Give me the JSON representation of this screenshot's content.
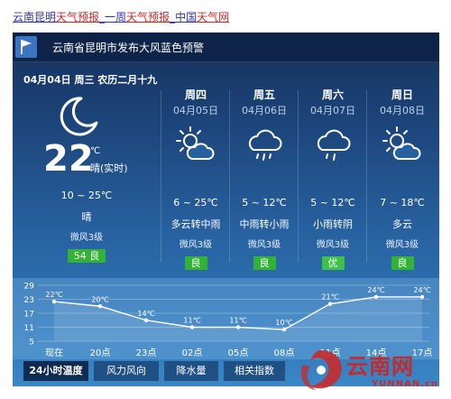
{
  "breadcrumb": [
    {
      "text": "云南昆明",
      "color": "#3333aa"
    },
    {
      "text": "天气预报",
      "color": "#cc2a2a"
    },
    {
      "text": "_",
      "color": "#3333aa"
    },
    {
      "text": "一周",
      "color": "#3333aa"
    },
    {
      "text": "天气预报",
      "color": "#cc2a2a"
    },
    {
      "text": "_",
      "color": "#3333aa"
    },
    {
      "text": "中国",
      "color": "#3333aa"
    },
    {
      "text": "天气网",
      "color": "#cc2a2a"
    }
  ],
  "alert": {
    "text": "云南省昆明市发布大风蓝色预警"
  },
  "today": {
    "date_text": "04月04日 周三 农历二月十九",
    "temp": "22",
    "unit": "℃",
    "status": "晴(实时)",
    "range": "10 ~ 25℃",
    "desc": "晴",
    "wind": "微风3级",
    "aqi": "54 良",
    "icon": "moon-icon"
  },
  "forecast": [
    {
      "day": "周四",
      "date": "04月05日",
      "icon": "partly-cloudy-icon",
      "range": "6 ~ 25℃",
      "desc": "多云转中雨",
      "wind": "微风3级",
      "aqi": "良"
    },
    {
      "day": "周五",
      "date": "04月06日",
      "icon": "rain-cloud-icon",
      "range": "5 ~ 12℃",
      "desc": "中雨转小雨",
      "wind": "微风3级",
      "aqi": "良"
    },
    {
      "day": "周六",
      "date": "04月07日",
      "icon": "rain-cloud-icon",
      "range": "5 ~ 12℃",
      "desc": "小雨转阴",
      "wind": "微风3级",
      "aqi": "优"
    },
    {
      "day": "周日",
      "date": "04月08日",
      "icon": "partly-cloudy-icon",
      "range": "7 ~ 18℃",
      "desc": "多云",
      "wind": "微风3级",
      "aqi": "良"
    }
  ],
  "chart_data": {
    "type": "line",
    "categories": [
      "现在",
      "20点",
      "23点",
      "02点",
      "05点",
      "08点",
      "11点",
      "14点",
      "17点"
    ],
    "values": [
      22,
      20,
      14,
      11,
      11,
      10,
      21,
      24,
      24
    ],
    "value_labels": [
      "22℃",
      "20℃",
      "14℃",
      "11℃",
      "11℃",
      "10℃",
      "21℃",
      "24℃",
      "24℃"
    ],
    "yticks": [
      5,
      11,
      17,
      23,
      29
    ],
    "ylim": [
      5,
      29
    ],
    "grid": true
  },
  "tabs": [
    {
      "label": "24小时温度",
      "active": true
    },
    {
      "label": "风力风向",
      "active": false
    },
    {
      "label": "降水量",
      "active": false
    },
    {
      "label": "相关指数",
      "active": false
    }
  ],
  "watermark": {
    "text": "云南网",
    "sub": "YUNNAN.cn"
  },
  "colors": {
    "aqi_good": "#33b336",
    "aqi_excellent": "#3ec24a",
    "chart_fill": "#7fb6e6",
    "watermark": "#c42b2b"
  }
}
